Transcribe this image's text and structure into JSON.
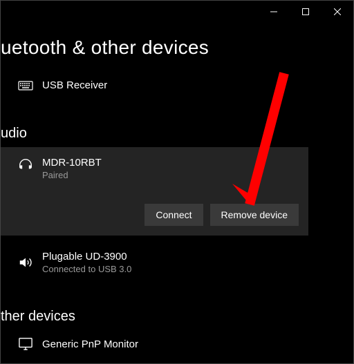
{
  "page": {
    "title": "uetooth & other devices"
  },
  "sections": {
    "top_device": {
      "name": "USB Receiver"
    },
    "audio": {
      "header": "udio",
      "selected": {
        "name": "MDR-10RBT",
        "status": "Paired",
        "connect_label": "Connect",
        "remove_label": "Remove device"
      },
      "other": {
        "name": "Plugable UD-3900",
        "status": "Connected to USB 3.0"
      }
    },
    "other_devices": {
      "header": "ther devices",
      "monitor": {
        "name": "Generic PnP Monitor"
      }
    }
  }
}
